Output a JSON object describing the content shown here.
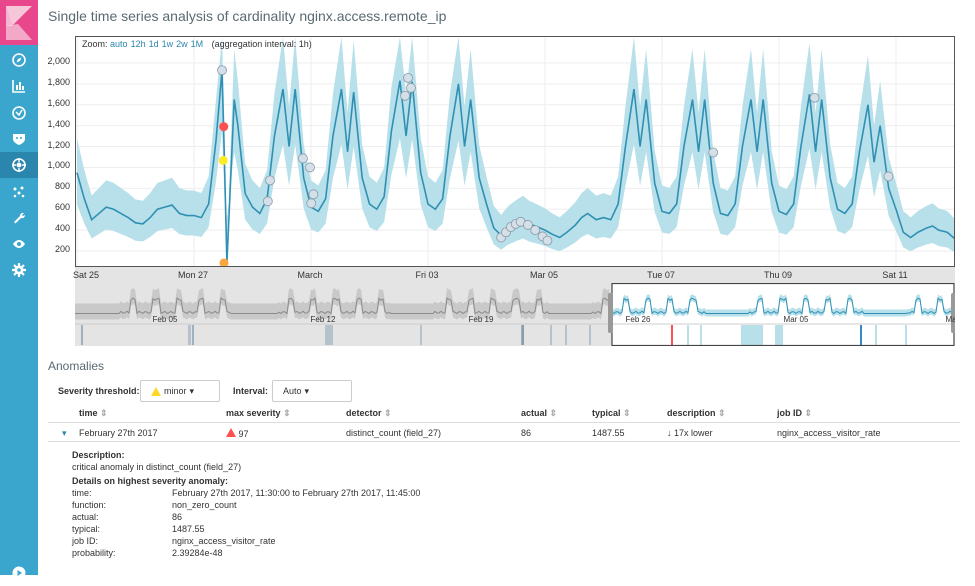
{
  "sidebar": {
    "items": [
      "compass-icon",
      "bar-chart-icon",
      "timelion-icon",
      "shield-icon",
      "machine-learning-icon",
      "graph-icon",
      "wrench-icon",
      "eye-icon",
      "gear-icon"
    ],
    "selected": "machine-learning-icon",
    "bottom": "play-icon",
    "colors": {
      "bar": "#3aa5cd",
      "logo": "#e8488b",
      "selected": "#2a86ad"
    }
  },
  "title": "Single time series analysis of cardinality nginx.access.remote_ip",
  "zoom": {
    "label": "Zoom:",
    "options": [
      "auto",
      "12h",
      "1d",
      "1w",
      "2w",
      "1M"
    ],
    "interval": "(aggregation interval: 1h)"
  },
  "chart_data": {
    "type": "line",
    "ylim": [
      57,
      2248
    ],
    "yticks": [
      "200",
      "400",
      "600",
      "800",
      "1,000",
      "1,200",
      "1,400",
      "1,600",
      "1,800",
      "2,000"
    ],
    "ytick_values": [
      200,
      400,
      600,
      800,
      1000,
      1200,
      1400,
      1600,
      1800,
      2000
    ],
    "xticks": [
      {
        "label": "Sat 25",
        "date": "2017-02-25"
      },
      {
        "label": "Mon 27",
        "date": "2017-02-27"
      },
      {
        "label": "March",
        "date": "2017-03-01"
      },
      {
        "label": "Fri 03",
        "date": "2017-03-03"
      },
      {
        "label": "Mar 05",
        "date": "2017-03-05"
      },
      {
        "label": "Tue 07",
        "date": "2017-03-07"
      },
      {
        "label": "Thu 09",
        "date": "2017-03-09"
      },
      {
        "label": "Sat 11",
        "date": "2017-03-11"
      }
    ],
    "xlim": [
      "2017-02-25",
      "2017-03-12"
    ],
    "colors": {
      "line": "#3090b4",
      "band": "#b7e0ea",
      "marker": "#d4dfe8",
      "critical": "#fe5050",
      "major": "#fba740",
      "minor": "#fdec25"
    },
    "days": [
      {
        "date": "2017-02-25",
        "hours": [
          0,
          3,
          6,
          9,
          12,
          15,
          18,
          21
        ],
        "values": [
          950,
          700,
          500,
          560,
          620,
          600,
          560,
          520
        ]
      },
      {
        "date": "2017-02-26",
        "hours": [
          0,
          3,
          6,
          9,
          12,
          15,
          18,
          21
        ],
        "values": [
          470,
          460,
          520,
          600,
          620,
          640,
          560,
          540
        ]
      },
      {
        "date": "2017-02-27",
        "hours": [
          0,
          3,
          6,
          9,
          11.5,
          12.5,
          13.5,
          16.5,
          18,
          21
        ],
        "values": [
          540,
          520,
          650,
          1250,
          1930,
          1050,
          86,
          1650,
          1400,
          750
        ]
      },
      {
        "date": "2017-02-28",
        "hours": [
          0,
          3,
          6,
          9,
          12.5,
          15,
          17.5,
          21
        ],
        "values": [
          620,
          560,
          700,
          1300,
          1750,
          1200,
          1750,
          900
        ]
      },
      {
        "date": "2017-03-01",
        "hours": [
          0,
          3,
          6,
          9,
          12.5,
          15,
          17.5,
          21
        ],
        "values": [
          620,
          580,
          700,
          1300,
          1750,
          1150,
          1720,
          900
        ]
      },
      {
        "date": "2017-03-02",
        "hours": [
          0,
          3,
          6,
          9,
          12.5,
          15,
          17.5,
          21
        ],
        "values": [
          650,
          600,
          720,
          1350,
          1830,
          1300,
          1820,
          950
        ]
      },
      {
        "date": "2017-03-03",
        "hours": [
          0,
          3,
          6,
          9,
          12.5,
          15,
          17.5,
          21
        ],
        "values": [
          650,
          600,
          700,
          1300,
          1800,
          1200,
          1650,
          900
        ]
      },
      {
        "date": "2017-03-04",
        "hours": [
          0,
          3,
          6,
          9,
          12.5,
          15,
          17.5,
          21
        ],
        "values": [
          650,
          420,
          350,
          420,
          470,
          500,
          460,
          430
        ]
      },
      {
        "date": "2017-03-05",
        "hours": [
          0,
          3,
          6,
          9,
          12.5,
          15,
          17.5,
          21
        ],
        "values": [
          400,
          360,
          330,
          380,
          450,
          520,
          560,
          500
        ]
      },
      {
        "date": "2017-03-06",
        "hours": [
          0,
          3,
          6,
          9,
          12.5,
          15,
          17.5,
          21
        ],
        "values": [
          520,
          500,
          650,
          1200,
          1750,
          1200,
          1650,
          850
        ]
      },
      {
        "date": "2017-03-07",
        "hours": [
          0,
          3,
          6,
          9,
          12.5,
          15,
          17.5,
          21
        ],
        "values": [
          580,
          560,
          650,
          1200,
          1650,
          1150,
          1650,
          850
        ]
      },
      {
        "date": "2017-03-08",
        "hours": [
          0,
          3,
          6,
          9,
          12.5,
          15,
          17.5,
          21
        ],
        "values": [
          560,
          540,
          650,
          1200,
          1650,
          1150,
          1650,
          850
        ]
      },
      {
        "date": "2017-03-09",
        "hours": [
          0,
          3,
          6,
          9,
          12.5,
          15,
          17.5,
          21
        ],
        "values": [
          580,
          550,
          650,
          1200,
          1700,
          1150,
          1650,
          900
        ]
      },
      {
        "date": "2017-03-10",
        "hours": [
          0,
          3,
          6,
          9,
          12.5,
          15,
          17.5,
          21
        ],
        "values": [
          600,
          560,
          650,
          1150,
          1600,
          1050,
          1400,
          800
        ]
      },
      {
        "date": "2017-03-11",
        "hours": [
          0,
          3,
          6,
          9,
          12.5,
          15,
          17.5,
          21
        ],
        "values": [
          600,
          380,
          330,
          380,
          420,
          440,
          400,
          380
        ]
      },
      {
        "date": "2017-03-12",
        "hours": [
          0
        ],
        "values": [
          320
        ]
      }
    ],
    "anomalies": [
      {
        "date": "2017-02-27",
        "hour": 11.5,
        "value": 1930,
        "severity": "low"
      },
      {
        "date": "2017-02-27",
        "hour": 12.2,
        "value": 1390,
        "severity": "critical"
      },
      {
        "date": "2017-02-27",
        "hour": 12.0,
        "value": 1067,
        "severity": "minor"
      },
      {
        "date": "2017-02-27",
        "hour": 12.3,
        "value": 86,
        "severity": "major"
      },
      {
        "date": "2017-02-28",
        "hour": 6.3,
        "value": 676,
        "severity": "low"
      },
      {
        "date": "2017-02-28",
        "hour": 7.2,
        "value": 876,
        "severity": "low"
      },
      {
        "date": "2017-02-28",
        "hour": 20.7,
        "value": 1086,
        "severity": "low"
      },
      {
        "date": "2017-02-28",
        "hour": 23.6,
        "value": 1000,
        "severity": "low"
      },
      {
        "date": "2017-03-01",
        "hour": 0.1,
        "value": 657,
        "severity": "low"
      },
      {
        "date": "2017-03-01",
        "hour": 1.0,
        "value": 743,
        "severity": "low"
      },
      {
        "date": "2017-03-02",
        "hour": 14.6,
        "value": 1686,
        "severity": "low"
      },
      {
        "date": "2017-03-02",
        "hour": 15.8,
        "value": 1857,
        "severity": "low"
      },
      {
        "date": "2017-03-02",
        "hour": 17.0,
        "value": 1762,
        "severity": "low"
      },
      {
        "date": "2017-03-04",
        "hour": 6,
        "value": 330,
        "severity": "low"
      },
      {
        "date": "2017-03-04",
        "hour": 8,
        "value": 380,
        "severity": "low"
      },
      {
        "date": "2017-03-04",
        "hour": 10,
        "value": 430,
        "severity": "low"
      },
      {
        "date": "2017-03-04",
        "hour": 12,
        "value": 460,
        "severity": "low"
      },
      {
        "date": "2017-03-04",
        "hour": 14,
        "value": 480,
        "severity": "low"
      },
      {
        "date": "2017-03-04",
        "hour": 17,
        "value": 450,
        "severity": "low"
      },
      {
        "date": "2017-03-04",
        "hour": 20,
        "value": 400,
        "severity": "low"
      },
      {
        "date": "2017-03-04",
        "hour": 23,
        "value": 340,
        "severity": "low"
      },
      {
        "date": "2017-03-05",
        "hour": 1,
        "value": 300,
        "severity": "low"
      },
      {
        "date": "2017-03-07",
        "hour": 21,
        "value": 1143,
        "severity": "low"
      },
      {
        "date": "2017-03-09",
        "hour": 14.6,
        "value": 1667,
        "severity": "low"
      },
      {
        "date": "2017-03-10",
        "hour": 20.9,
        "value": 914,
        "severity": "low"
      }
    ]
  },
  "overview": {
    "ticks": [
      "Feb 05",
      "Feb 12",
      "Feb 19",
      "Feb 26",
      "Mar 05",
      "Ma"
    ]
  },
  "anomalies": {
    "heading": "Anomalies",
    "severity_label": "Severity threshold:",
    "severity_value": "minor",
    "interval_label": "Interval:",
    "interval_value": "Auto",
    "columns": [
      "time",
      "max severity",
      "detector",
      "actual",
      "typical",
      "description",
      "job ID"
    ],
    "row": {
      "time": "February 27th 2017",
      "severity": "97",
      "detector": "distinct_count (field_27)",
      "actual": "86",
      "typical": "1487.55",
      "description": "17x lower",
      "job_id": "nginx_access_visitor_rate"
    },
    "details": {
      "description_label": "Description:",
      "description": "critical anomaly in distinct_count (field_27)",
      "highest_label": "Details on highest severity anomaly:",
      "fields": [
        [
          "time:",
          "February 27th 2017, 11:30:00 to February 27th 2017, 11:45:00"
        ],
        [
          "function:",
          "non_zero_count"
        ],
        [
          "actual:",
          "86"
        ],
        [
          "typical:",
          "1487.55"
        ],
        [
          "job ID:",
          "nginx_access_visitor_rate"
        ],
        [
          "probability:",
          "2.39284e-48"
        ]
      ]
    }
  }
}
